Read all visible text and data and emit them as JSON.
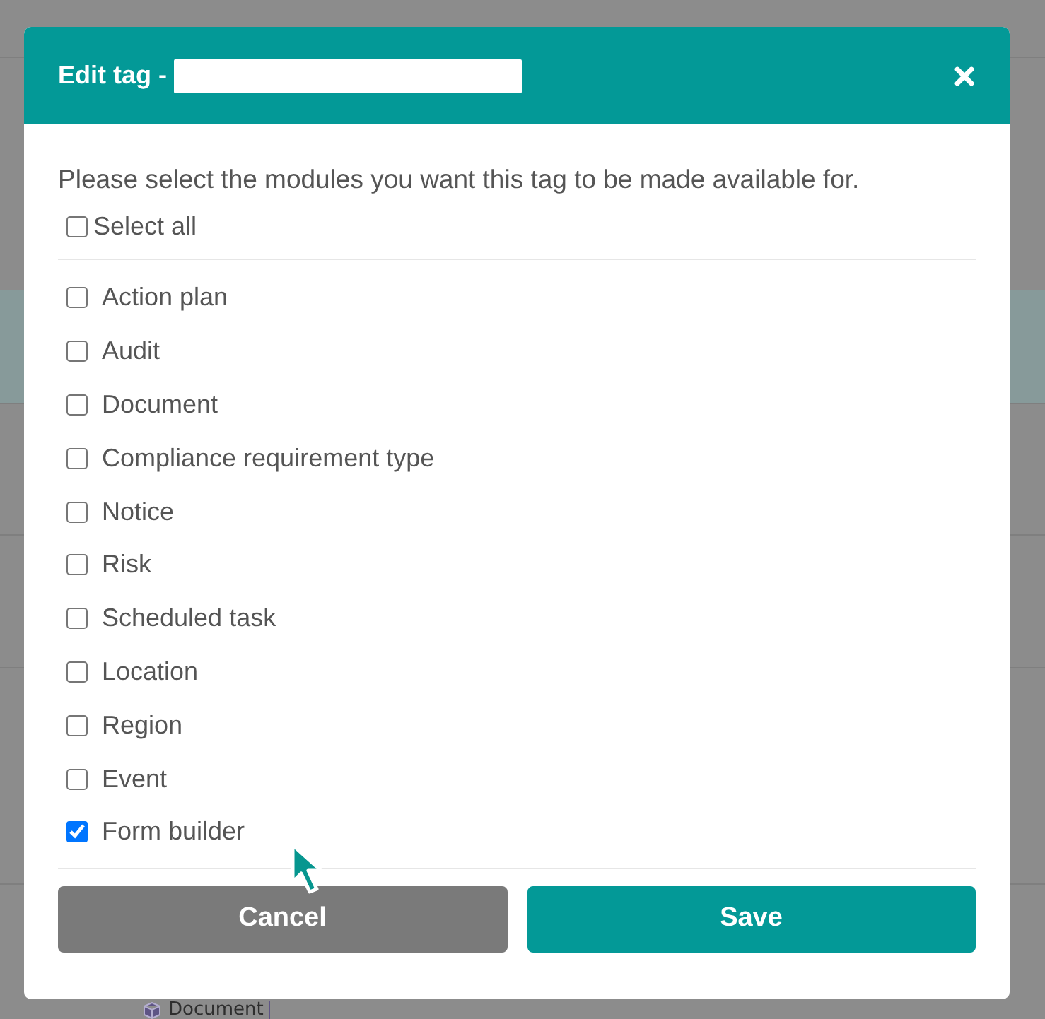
{
  "background": {
    "chip_label": "Document"
  },
  "dialog": {
    "title": "Edit tag -",
    "description": "Please select the modules you want this tag to be made available for.",
    "select_all": {
      "label": "Select all",
      "checked": false
    },
    "modules": [
      {
        "label": "Action plan",
        "checked": false
      },
      {
        "label": "Audit",
        "checked": false
      },
      {
        "label": "Document",
        "checked": false
      },
      {
        "label": "Compliance requirement type",
        "checked": false
      },
      {
        "label": "Notice",
        "checked": false
      },
      {
        "label": "Risk",
        "checked": false
      },
      {
        "label": "Scheduled task",
        "checked": false
      },
      {
        "label": "Location",
        "checked": false
      },
      {
        "label": "Region",
        "checked": false
      },
      {
        "label": "Event",
        "checked": false
      },
      {
        "label": "Form builder",
        "checked": true
      }
    ],
    "buttons": [
      {
        "label": "Cancel",
        "kind": "secondary"
      },
      {
        "label": "Save",
        "kind": "primary"
      }
    ]
  }
}
